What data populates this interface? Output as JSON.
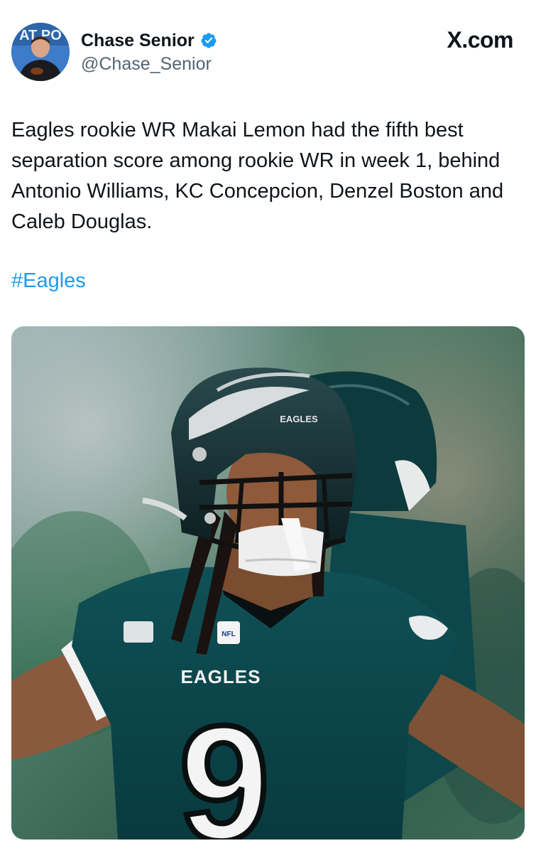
{
  "author": {
    "display_name": "Chase Senior",
    "handle": "@Chase_Senior",
    "verified": true,
    "avatar_text": "AT PO"
  },
  "brand": "X.com",
  "tweet": {
    "text": "Eagles rookie WR Makai Lemon had the fifth best separation score among rookie WR in week 1, behind Antonio Williams, KC Concepcion, Denzel Boston and Caleb Douglas.",
    "hashtag": "#Eagles"
  },
  "photo": {
    "helmet_text": "EAGLES",
    "jersey_text": "EAGLES",
    "jersey_number": "9",
    "logo_text": "NFL"
  },
  "colors": {
    "link": "#1d9bf0",
    "verified": "#1d9bf0",
    "eagles_green": "#0b4a4e",
    "text": "#0f1419",
    "secondary": "#536471"
  }
}
